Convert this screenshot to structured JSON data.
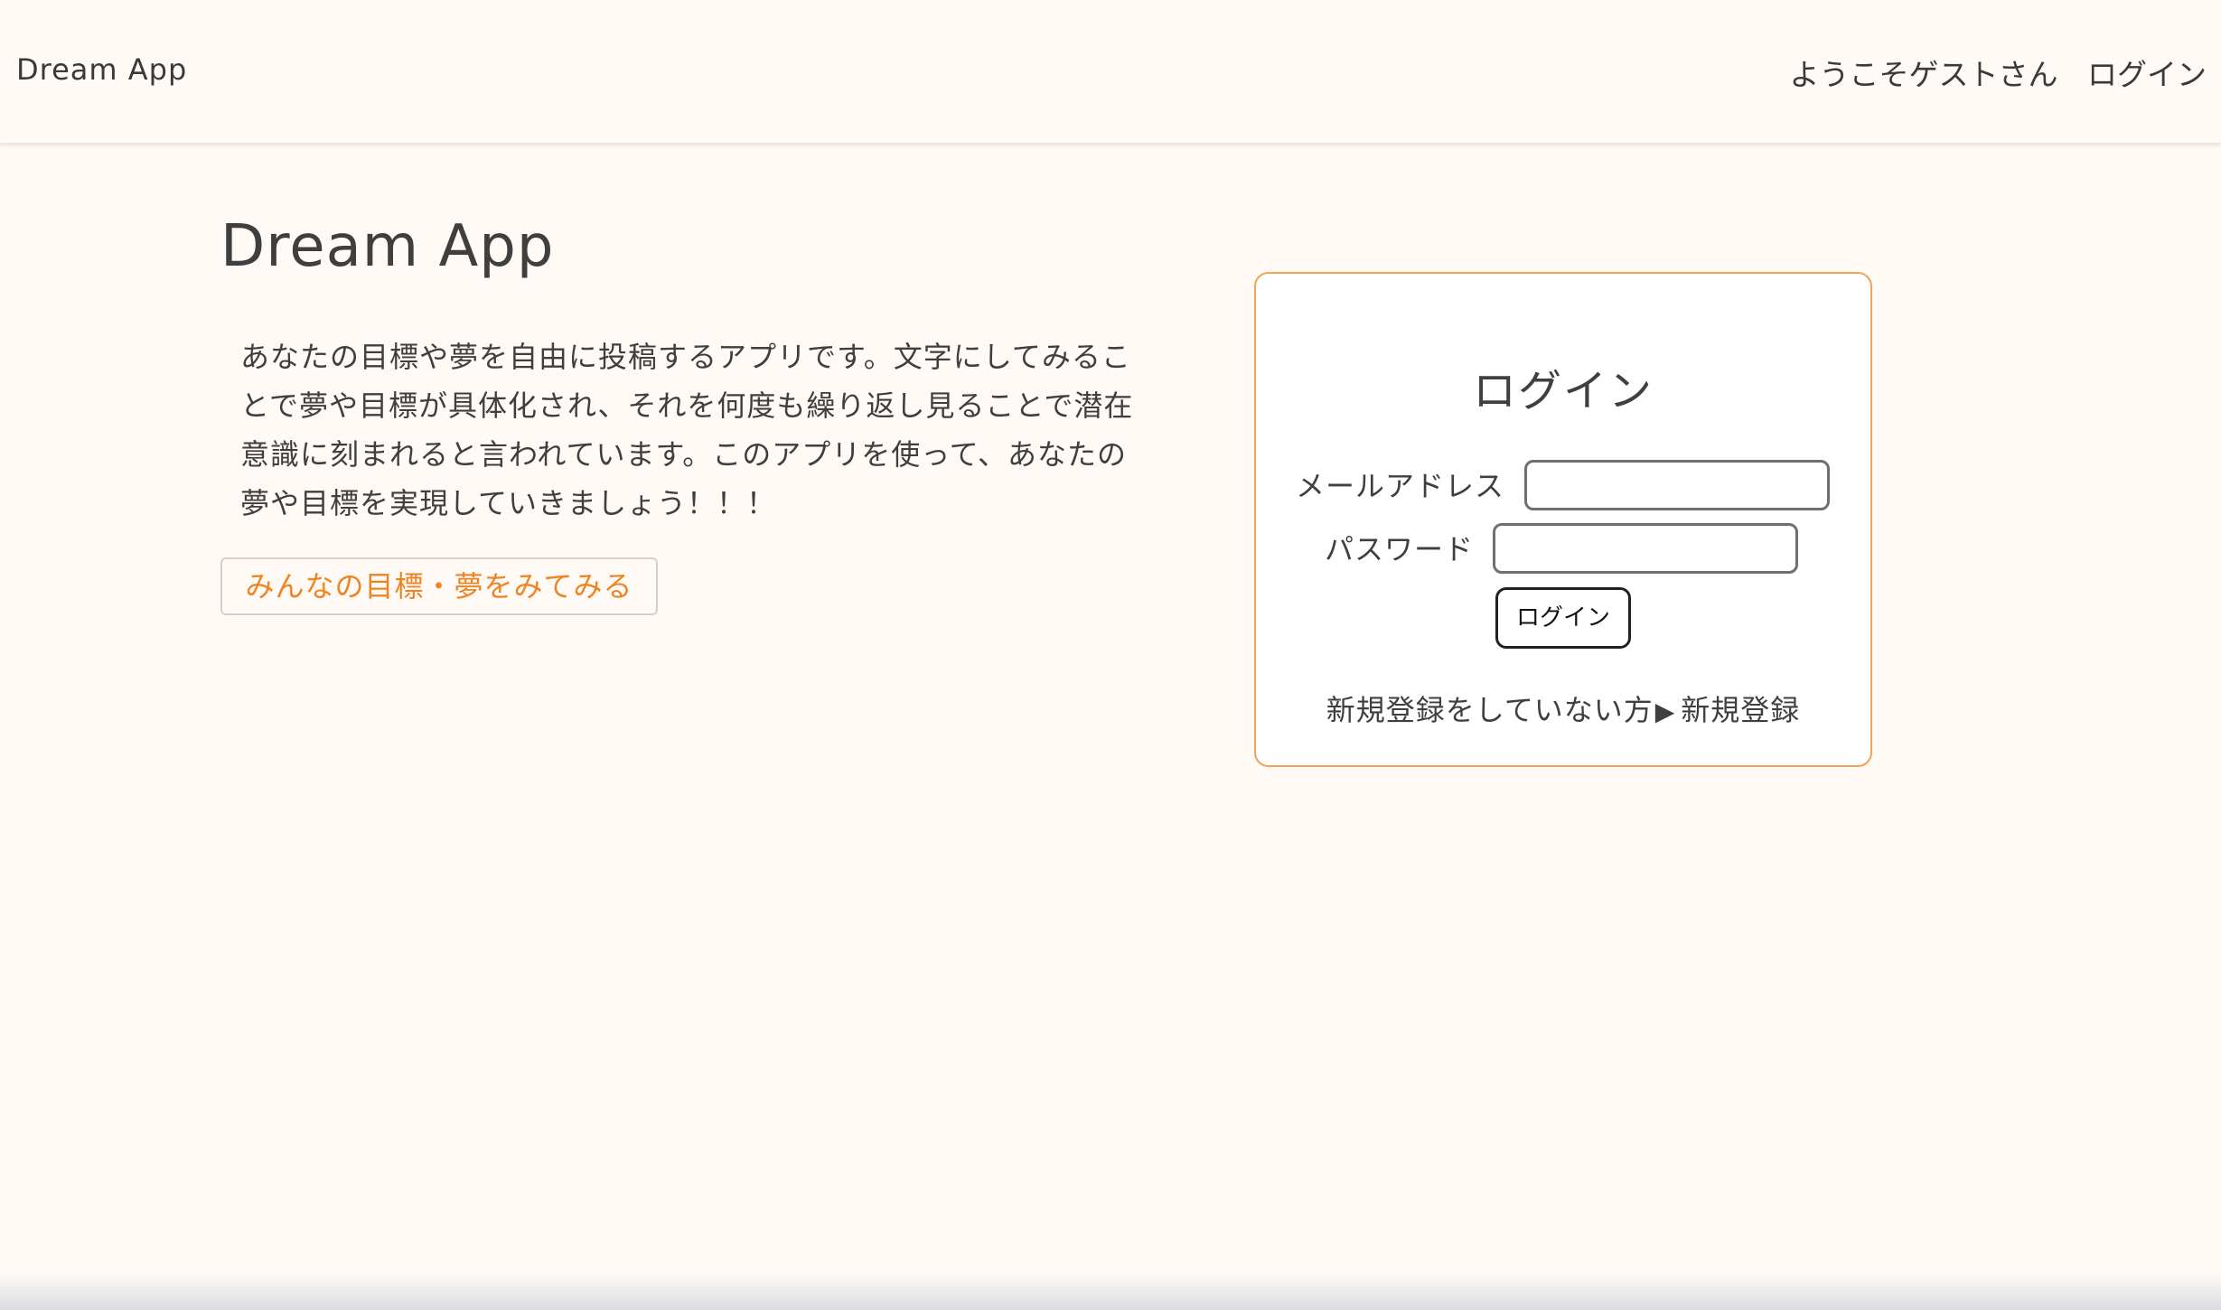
{
  "header": {
    "brand": "Dream App",
    "greeting": "ようこそゲストさん",
    "login_link": "ログイン"
  },
  "hero": {
    "title": "Dream App",
    "description": "あなたの目標や夢を自由に投稿するアプリです。文字にしてみることで夢や目標が具体化され、それを何度も繰り返し見ることで潜在意識に刻まれると言われています。このアプリを使って、あなたの夢や目標を実現していきましょう！！！",
    "explore_button": "みんなの目標・夢をみてみる"
  },
  "login_form": {
    "title": "ログイン",
    "email_label": "メールアドレス",
    "email_value": "",
    "password_label": "パスワード",
    "password_value": "",
    "submit_label": "ログイン",
    "signup_prompt": "新規登録をしていない方",
    "signup_arrow": "▶",
    "signup_link": "新規登録"
  },
  "colors": {
    "background": "#fffaf6",
    "accent": "#ee8422",
    "card_border": "#f1a455",
    "text": "#3f3f3f"
  }
}
